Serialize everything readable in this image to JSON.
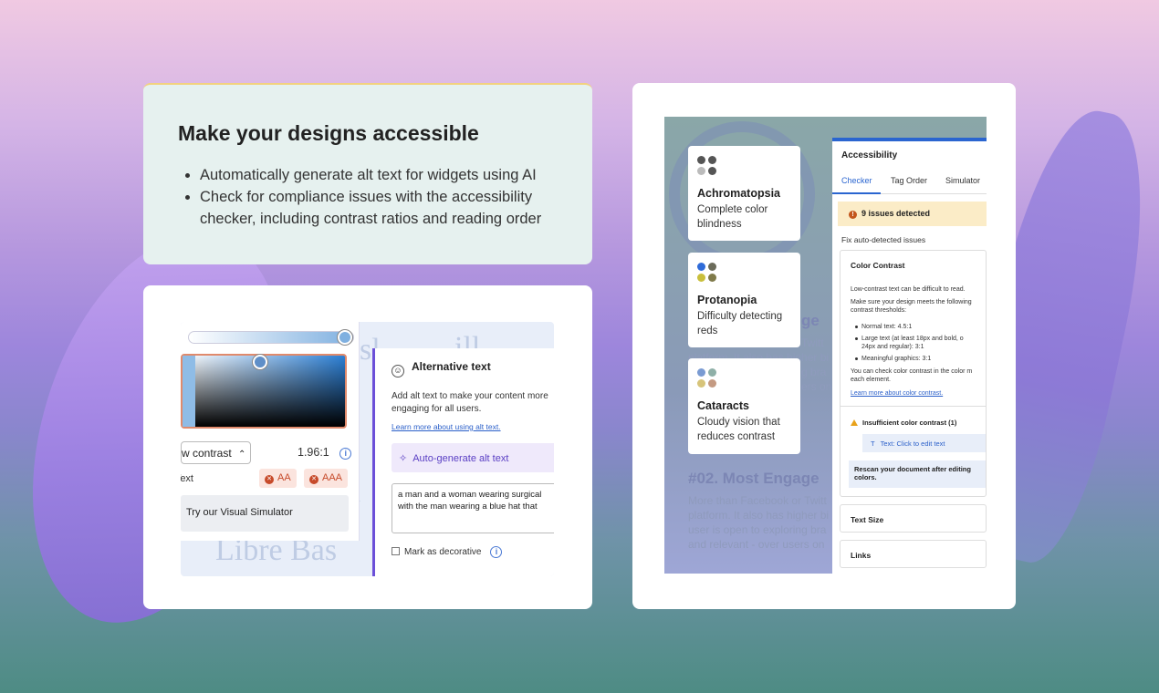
{
  "colors": {
    "accent": "#6b4fd8",
    "link": "#2a5fc9",
    "fail": "#c74a2a",
    "warning_bg": "#fbecc7"
  },
  "hero": {
    "title": "Make your designs accessible",
    "bullets": [
      "Automatically generate alt text for widgets using AI",
      "Check for compliance issues with the accessibility checker, including contrast ratios and reading order"
    ]
  },
  "editor": {
    "ghost_text_1": "sl",
    "ghost_text_2": "ill",
    "ghost_text_3": "a",
    "ghost_text_4": "Libre Bas",
    "contrast_select": "w contrast",
    "contrast_ratio": "1.96:1",
    "text_label": "Text",
    "badge_aa": "AA",
    "badge_aaa": "AAA",
    "simulator_button": "Try our Visual Simulator",
    "alt_panel": {
      "title": "Alternative text",
      "description": "Add alt text to make your content more engaging for all users.",
      "learn_link": "Learn more about using alt text.",
      "auto_generate": "Auto-generate alt text",
      "textarea_line1": "a man and a woman wearing surgical",
      "textarea_line2": "with the man wearing a blue hat that",
      "decorative_label": "Mark as decorative"
    }
  },
  "checker": {
    "ghost": {
      "h1": "#02. Most Engage",
      "h_top": "ge",
      "p1": "More than Facebook or Twitt",
      "p2": "platform. It also has higher bi",
      "p3": "user is open to exploring bra",
      "p4": "and relevant - over users on",
      "mid1": "Twitt",
      "mid2": "platform. It also has higher bi",
      "mid3": "g bra",
      "mid4": "ers on"
    },
    "vision_cards": [
      {
        "title": "Achromatopsia",
        "desc": "Complete color blindness",
        "dots": [
          "#555555",
          "#555555",
          "#bbbbbb",
          "#555555"
        ]
      },
      {
        "title": "Protanopia",
        "desc": "Difficulty detecting reds",
        "dots": [
          "#2f6bd8",
          "#6b6b5a",
          "#c9bf3c",
          "#7f7a4a"
        ]
      },
      {
        "title": "Cataracts",
        "desc": "Cloudy vision that reduces contrast",
        "dots": [
          "#7a9bd2",
          "#8fb0a8",
          "#d7c47a",
          "#c49a82"
        ]
      }
    ],
    "panel": {
      "title": "Accessibility",
      "tabs": [
        "Checker",
        "Tag Order",
        "Simulator"
      ],
      "issues": "9 issues detected",
      "fix_label": "Fix auto-detected issues",
      "contrast": {
        "title": "Color Contrast",
        "line1": "Low-contrast text can be difficult to read.",
        "line2": "Make sure your design meets the following",
        "line3": "contrast thresholds:",
        "b1": "Normal text: 4.5:1",
        "b2a": "Large text (at least 18px and bold, o",
        "b2b": "24px and regular): 3:1",
        "b3": "Meaningful graphics: 3:1",
        "line4": "You can check color contrast in the color m",
        "line5": "each element.",
        "link": "Learn more about color contrast.",
        "insufficient": "Insufficient color contrast (1)",
        "edit_text": "Text: Click to edit text",
        "rescan1": "Rescan your document after editing",
        "rescan2": "colors."
      },
      "text_size": "Text Size",
      "links": "Links"
    }
  }
}
